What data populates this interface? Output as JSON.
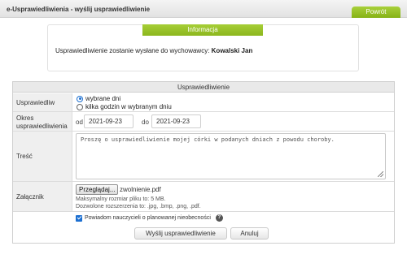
{
  "header": {
    "title": "e-Usprawiedliwienia - wyślij usprawiedliwienie",
    "back_label": "Powrót"
  },
  "info": {
    "heading": "Informacja",
    "text": "Usprawiedliwienie zostanie wysłane do wychowawcy:",
    "recipient": "Kowalski Jan"
  },
  "form": {
    "heading": "Usprawiedliwienie",
    "excuse": {
      "label": "Usprawiedliw",
      "options": [
        "wybrane dni",
        "kilka godzin w wybranym dniu"
      ],
      "selected": "wybrane dni"
    },
    "period": {
      "label_line1": "Okres",
      "label_line2": "usprawiedliwienia",
      "from_label": "od",
      "from_value": "2021-09-23",
      "to_label": "do",
      "to_value": "2021-09-23"
    },
    "content": {
      "label": "Treść",
      "value": "Proszę o usprawiedliwienie mojej córki w podanych dniach z powodu choroby."
    },
    "attachment": {
      "label": "Załącznik",
      "browse_label": "Przeglądaj...",
      "file_name": "zwolnienie.pdf",
      "max_size": "Maksymalny rozmiar pliku to: 5 MB.",
      "extensions": "Dozwolone rozszerzenia to: .jpg, .bmp, .png, .pdf."
    },
    "notify": {
      "label": "Powiadom nauczycieli o planowanej nieobecności",
      "checked": true,
      "help": "?"
    },
    "submit_label": "Wyślij usprawiedliwienie",
    "cancel_label": "Anuluj"
  }
}
